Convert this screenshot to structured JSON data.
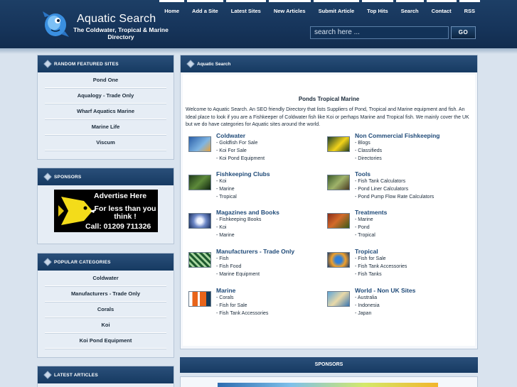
{
  "header": {
    "logo_title": "Aquatic Search",
    "logo_subtitle": "The Coldwater, Tropical  & Marine Directory",
    "nav": [
      "Home",
      "Add a Site",
      "Latest Sites",
      "New Articles",
      "Submit Article",
      "Top Hits",
      "Search",
      "Contact",
      "RSS"
    ],
    "search_placeholder": "search here ...",
    "go_label": "GO"
  },
  "sidebar": {
    "featured": {
      "title": "RANDOM FEATURED SITES",
      "items": [
        "Pond One",
        "Aqualogy - Trade Only",
        "Wharf Aquatics Marine",
        "Marine Life",
        "Viscum"
      ]
    },
    "sponsors": {
      "title": "SPONSORS",
      "ad_line1": "Advertise Here",
      "ad_line2": "For less than you think !",
      "ad_line3": "Call: 01209 711326"
    },
    "popular": {
      "title": "POPULAR CATEGORIES",
      "items": [
        "Coldwater",
        "Manufacturers - Trade Only",
        "Corals",
        "Koi",
        "Koi Pond Equipment"
      ]
    },
    "latest": {
      "title": "LATEST ARTICLES"
    }
  },
  "main": {
    "title": "Aquatic Search",
    "intro_title": "Ponds Tropical Marine",
    "intro_text": "Welcome to Aquatic Search. An SEO friendly Directory that lists Suppliers of Pond, Tropical and Marine equipment and fish. An Ideal place to look if you are a Fishkeeper of Coldwater fish like Koi or perhaps Marine and Tropical fish. We mainly cover the UK but we do have categories for Aquatic sites around the world.",
    "categories": [
      {
        "title": "Coldwater",
        "subs": [
          "- Goldfish For Sale",
          "- Koi For Sale",
          "- Koi Pond Equipment"
        ]
      },
      {
        "title": "Non Commercial Fishkeeping",
        "subs": [
          "- Blogs",
          "- Classifieds",
          "- Directories"
        ]
      },
      {
        "title": "Fishkeeping Clubs",
        "subs": [
          "- Koi",
          "- Marine",
          "- Tropical"
        ]
      },
      {
        "title": "Tools",
        "subs": [
          "- Fish Tank Calculators",
          "- Pond Liner Calculators",
          "- Pond Pump Flow Rate Calculators"
        ]
      },
      {
        "title": "Magazines and Books",
        "subs": [
          "- Fishkeeping Books",
          "- Koi",
          "- Marine"
        ]
      },
      {
        "title": "Treatments",
        "subs": [
          "- Marine",
          "- Pond",
          "- Tropical"
        ]
      },
      {
        "title": "Manufacturers - Trade Only",
        "subs": [
          "- Fish",
          "- Fish Food",
          "- Marine Equipment"
        ]
      },
      {
        "title": "Tropical",
        "subs": [
          "- Fish for Sale",
          "- Fish Tank Accessories",
          "- Fish Tanks"
        ]
      },
      {
        "title": "Marine",
        "subs": [
          "- Corals",
          "- Fish for Sale",
          "- Fish Tank Accessories"
        ]
      },
      {
        "title": "World - Non UK Sites",
        "subs": [
          "- Australia",
          "- Indonesia",
          "- Japan"
        ]
      }
    ],
    "sponsors_title": "SPONSORS"
  }
}
